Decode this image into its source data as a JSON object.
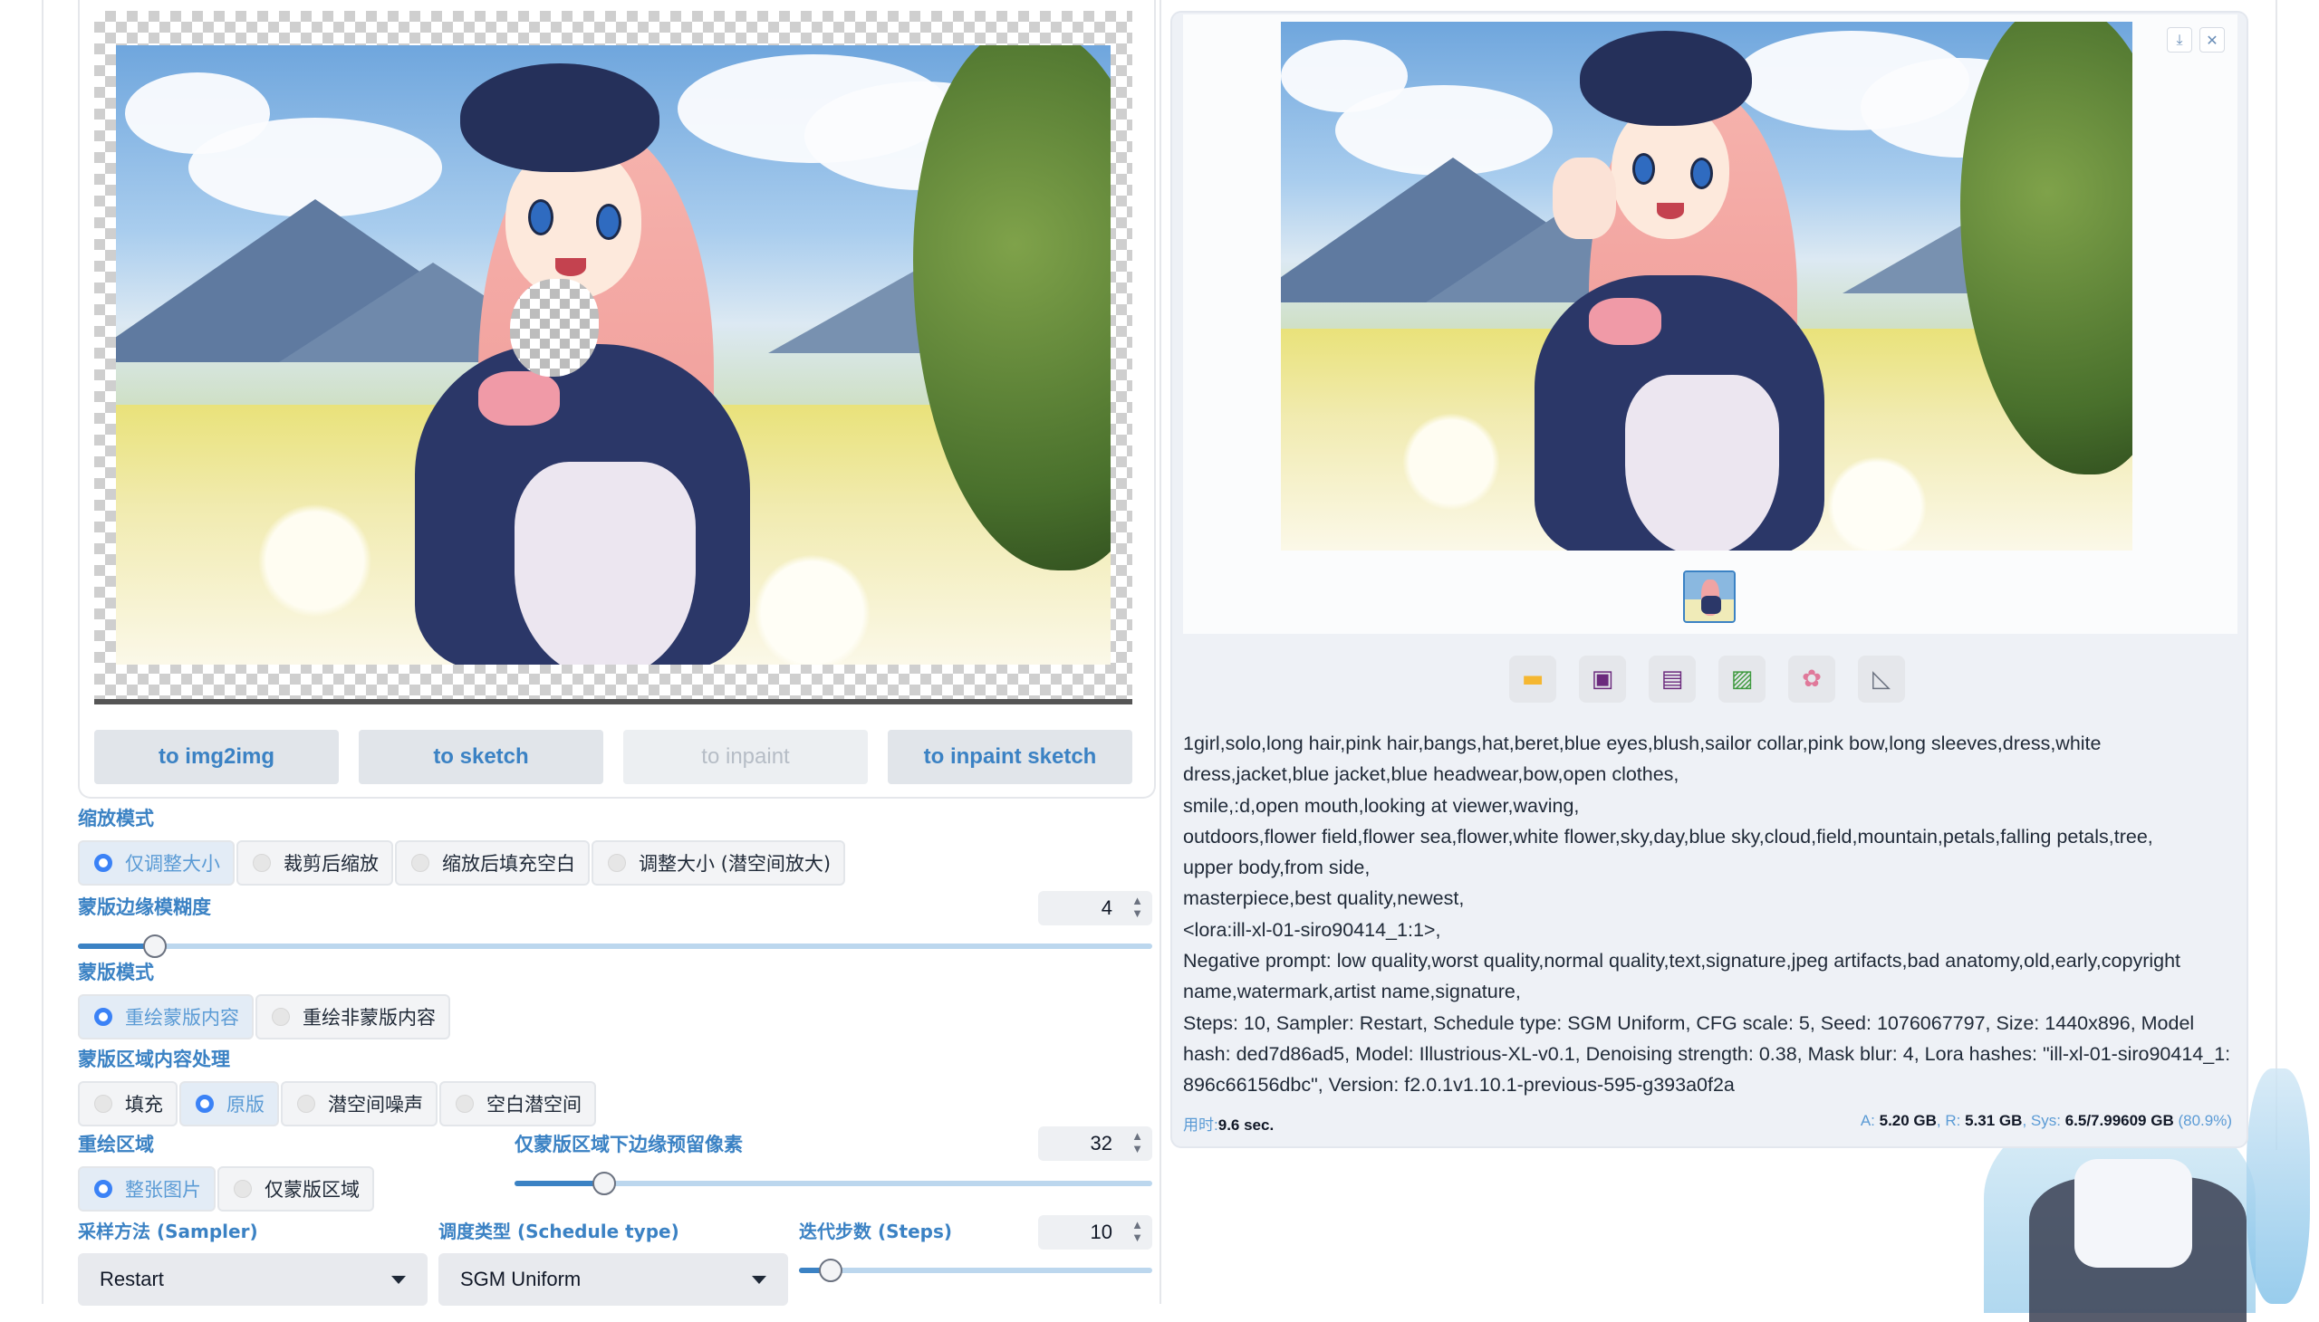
{
  "left_canvas": {
    "send_buttons": [
      {
        "label": "to img2img",
        "enabled": true
      },
      {
        "label": "to sketch",
        "enabled": true
      },
      {
        "label": "to inpaint",
        "enabled": false
      },
      {
        "label": "to inpaint sketch",
        "enabled": true
      }
    ]
  },
  "resize_mode": {
    "label": "缩放模式",
    "options": [
      "仅调整大小",
      "裁剪后缩放",
      "缩放后填充空白",
      "调整大小 (潜空间放大)"
    ],
    "selected": "仅调整大小"
  },
  "mask_blur": {
    "label": "蒙版边缘模糊度",
    "value": "4",
    "fraction": 0.078
  },
  "mask_mode": {
    "label": "蒙版模式",
    "options": [
      "重绘蒙版内容",
      "重绘非蒙版内容"
    ],
    "selected": "重绘蒙版内容"
  },
  "masked_content": {
    "label": "蒙版区域内容处理",
    "options": [
      "填充",
      "原版",
      "潜空间噪声",
      "空白潜空间"
    ],
    "selected": "原版"
  },
  "inpaint_area": {
    "label": "重绘区域",
    "options": [
      "整张图片",
      "仅蒙版区域"
    ],
    "selected": "整张图片"
  },
  "only_masked_padding": {
    "label": "仅蒙版区域下边缘预留像素",
    "value": "32",
    "fraction": 0.125
  },
  "sampler": {
    "label": "采样方法 (Sampler)",
    "value": "Restart"
  },
  "schedule_type": {
    "label": "调度类型 (Schedule type)",
    "value": "SGM Uniform"
  },
  "steps": {
    "label": "迭代步数 (Steps)",
    "value": "10",
    "fraction": 0.08
  },
  "output": {
    "top_buttons": [
      "download-icon",
      "close-icon"
    ],
    "tools": [
      "folder-icon",
      "save-icon",
      "zip-icon",
      "send-to-img2img-icon",
      "send-to-inpaint-icon",
      "send-to-extras-icon"
    ],
    "info_lines": [
      "1girl,solo,long hair,pink hair,bangs,hat,beret,blue eyes,blush,sailor collar,pink bow,long sleeves,dress,white dress,jacket,blue jacket,blue headwear,bow,open clothes,",
      "smile,:d,open mouth,looking at viewer,waving,",
      "outdoors,flower field,flower sea,flower,white flower,sky,day,blue sky,cloud,field,mountain,petals,falling petals,tree,",
      "upper body,from side,",
      "masterpiece,best quality,newest,",
      "<lora:ill-xl-01-siro90414_1:1>,",
      "Negative prompt: low quality,worst quality,normal quality,text,signature,jpeg artifacts,bad anatomy,old,early,copyright name,watermark,artist name,signature,",
      "Steps: 10, Sampler: Restart, Schedule type: SGM Uniform, CFG scale: 5, Seed: 1076067797, Size: 1440x896, Model hash: ded7d86ad5, Model: Illustrious-XL-v0.1, Denoising strength: 0.38, Mask blur: 4, Lora hashes: \"ill-xl-01-siro90414_1: 896c66156dbc\", Version: f2.0.1v1.10.1-previous-595-g393a0f2a"
    ],
    "time_label": "用时:",
    "time_value": "9.6 sec.",
    "mem": {
      "a_label": "A:",
      "a_value": "5.20 GB",
      "r_label": "R:",
      "r_value": "5.31 GB",
      "sys_label": "Sys:",
      "sys_value": "6.5/7.99609 GB",
      "sys_pct": "(80.9%)"
    }
  },
  "colors": {
    "accent": "#3b82c4",
    "panel_bg": "#eef1f6",
    "selected_radio_bg": "#e3ecf6"
  }
}
